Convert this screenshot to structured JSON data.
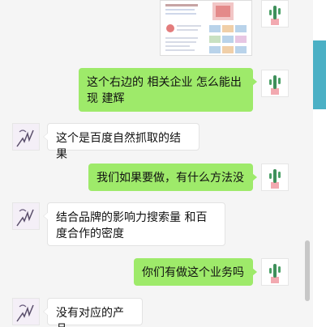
{
  "messages": [
    {
      "from": "me",
      "type": "image",
      "content": "search-result-screenshot"
    },
    {
      "from": "me",
      "type": "text",
      "text": "这个右边的  相关企业 怎么能出现 建辉"
    },
    {
      "from": "other",
      "type": "text",
      "text": "这个是百度自然抓取的结果"
    },
    {
      "from": "me",
      "type": "text",
      "text": "我们如果要做，有什么方法没"
    },
    {
      "from": "other",
      "type": "text",
      "text": "结合品牌的影响力搜索量 和百度合作的密度"
    },
    {
      "from": "me",
      "type": "text",
      "text": "你们有做这个业务吗"
    },
    {
      "from": "other",
      "type": "text",
      "text": "没有对应的产品"
    }
  ],
  "avatars": {
    "me": "cactus-plant-avatar",
    "other": "hand-sketch-avatar"
  },
  "colors": {
    "my_bubble": "#9eea6a",
    "other_bubble": "#ffffff",
    "background": "#f5f5f5",
    "accent": "#4bb0c5"
  }
}
